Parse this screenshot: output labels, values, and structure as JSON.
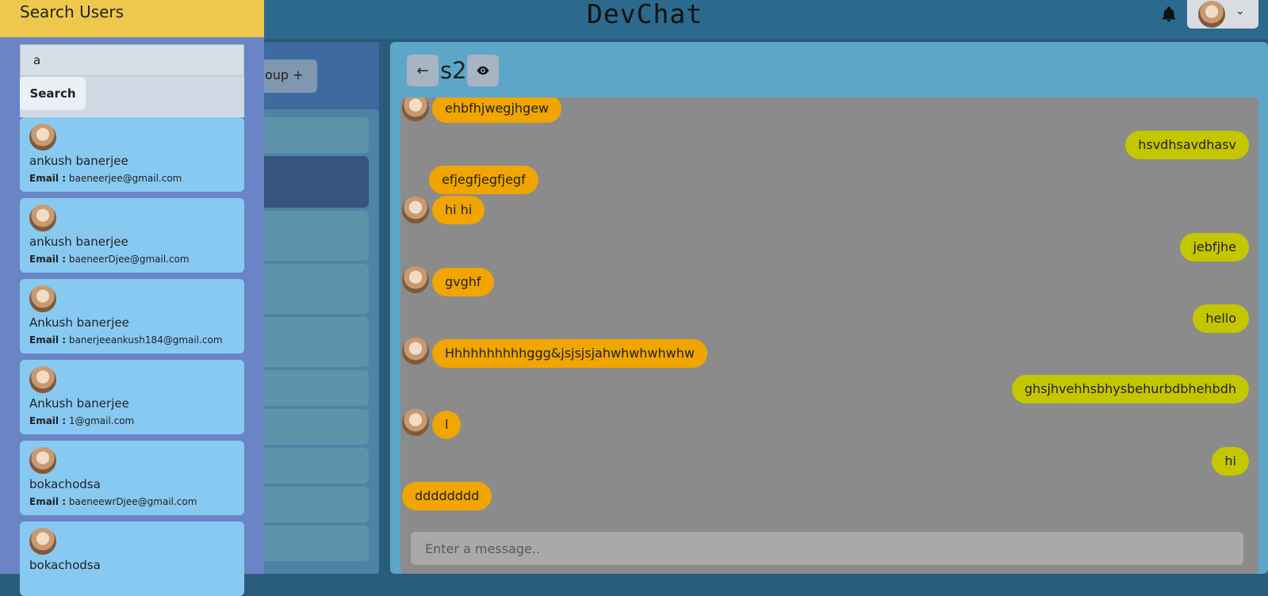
{
  "app": {
    "title": "DevChat"
  },
  "new_group": {
    "label": "oup +"
  },
  "chat": {
    "name": "s2",
    "messages": [
      {
        "text": "ehbfhjwegjhgew",
        "side": "in"
      },
      {
        "text": "hsvdhsavdhasv",
        "side": "out"
      },
      {
        "text": "efjegfjegfjegf",
        "side": "in"
      },
      {
        "text": "hi hi",
        "side": "in"
      },
      {
        "text": "jebfjhe",
        "side": "out"
      },
      {
        "text": "gvghf",
        "side": "in"
      },
      {
        "text": "hello",
        "side": "out"
      },
      {
        "text": "Hhhhhhhhhhggg&jsjsjsjahwhwhwhwhw",
        "side": "in"
      },
      {
        "text": "ghsjhvehhsbhysbehurbdbhehbdh",
        "side": "out"
      },
      {
        "text": "l",
        "side": "in"
      },
      {
        "text": "hi",
        "side": "out"
      },
      {
        "text": "dddddddd",
        "side": "in"
      }
    ],
    "input_placeholder": "Enter a message.."
  },
  "drawer": {
    "title": "Search Users",
    "search_value": "a",
    "search_button": "Search",
    "email_label": "Email :",
    "users": [
      {
        "name": "ankush banerjee",
        "email": "baeneerjee@gmail.com"
      },
      {
        "name": "ankush banerjee",
        "email": "baeneerDjee@gmail.com"
      },
      {
        "name": "Ankush banerjee",
        "email": "banerjeeankush184@gmail.com"
      },
      {
        "name": "Ankush banerjee",
        "email": "1@gmail.com"
      },
      {
        "name": "bokachodsa",
        "email": "baeneewrDjee@gmail.com"
      },
      {
        "name": "bokachodsa",
        "email": ""
      }
    ]
  }
}
